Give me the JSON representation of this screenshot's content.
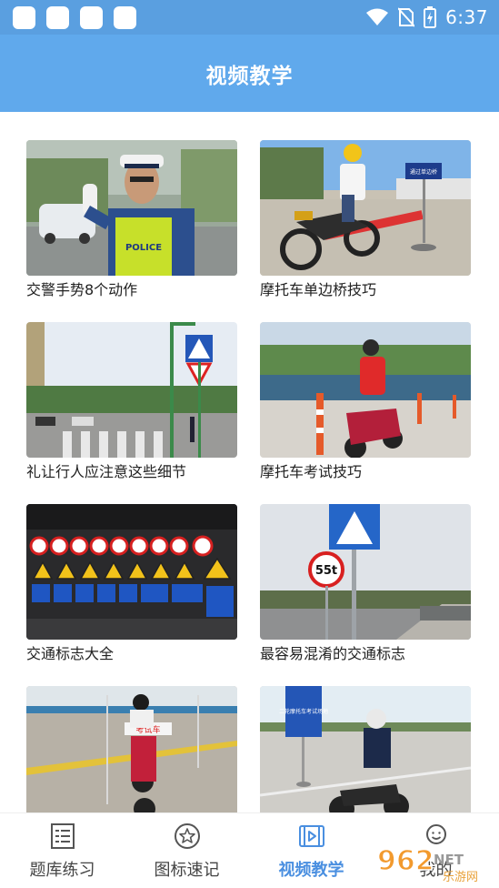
{
  "status_bar": {
    "time": "6:37"
  },
  "header": {
    "title": "视频教学"
  },
  "videos": [
    {
      "title": "交警手势8个动作",
      "thumb_text": "POLICE"
    },
    {
      "title": "摩托车单边桥技巧",
      "thumb_text": "通过单边桥"
    },
    {
      "title": "礼让行人应注意这些细节"
    },
    {
      "title": "摩托车考试技巧"
    },
    {
      "title": "交通标志大全"
    },
    {
      "title": "最容易混淆的交通标志",
      "thumb_text": "55t"
    },
    {
      "title": "",
      "thumb_text": "考试车"
    },
    {
      "title": "",
      "thumb_text": "二轮摩托车考试场地"
    }
  ],
  "tabs": [
    {
      "label": "题库练习",
      "icon": "list-icon",
      "active": false
    },
    {
      "label": "图标速记",
      "icon": "star-icon",
      "active": false
    },
    {
      "label": "视频教学",
      "icon": "video-icon",
      "active": true
    },
    {
      "label": "我的",
      "icon": "user-icon",
      "active": false
    }
  ],
  "watermark": {
    "text": "962",
    "suffix": "NET",
    "sub": "乐游网"
  },
  "colors": {
    "header": "#60a9ec",
    "status_bar": "#5a9fe0",
    "active_tab": "#4a8fe0"
  }
}
